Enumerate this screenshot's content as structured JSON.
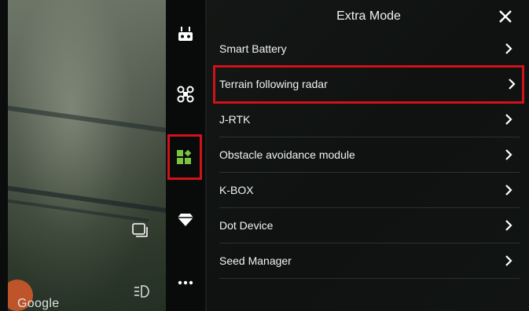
{
  "panel": {
    "title": "Extra Mode",
    "items": [
      {
        "label": "Smart Battery"
      },
      {
        "label": "Terrain following radar",
        "selected": true
      },
      {
        "label": "J-RTK"
      },
      {
        "label": "Obstacle avoidance module"
      },
      {
        "label": "K-BOX"
      },
      {
        "label": "Dot Device"
      },
      {
        "label": "Seed Manager"
      }
    ]
  },
  "rail": {
    "icons": [
      "remote-controller-icon",
      "drone-icon",
      "extra-mode-icon",
      "diamond-icon",
      "more-icon"
    ],
    "selected": "extra-mode-icon",
    "accent_color": "#7bc442",
    "highlight_color": "#d0121b"
  },
  "map": {
    "attribution": "Google"
  }
}
